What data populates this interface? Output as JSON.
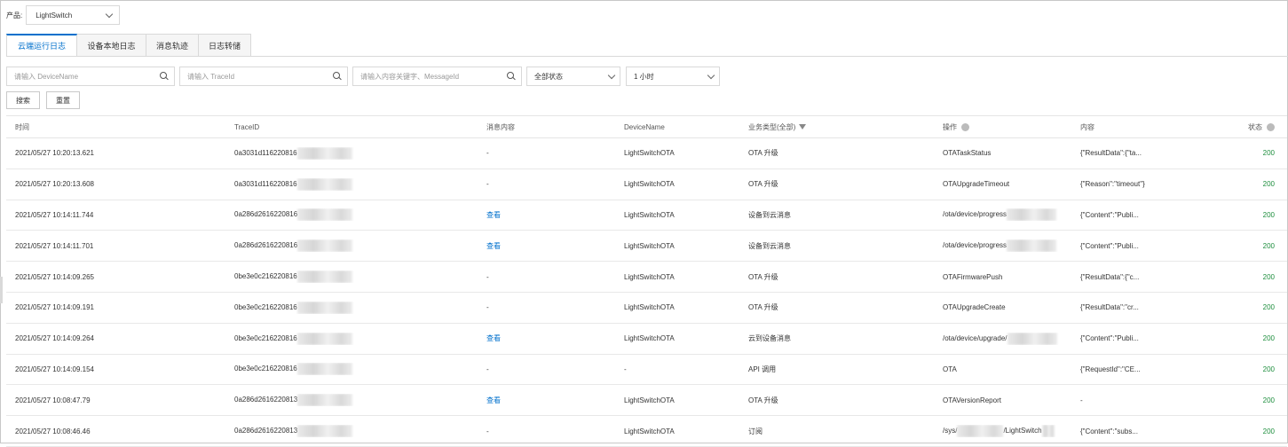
{
  "product": {
    "label": "产品:",
    "value": "LightSwitch"
  },
  "tabs": [
    {
      "label": "云端运行日志",
      "active": true
    },
    {
      "label": "设备本地日志",
      "active": false
    },
    {
      "label": "消息轨迹",
      "active": false
    },
    {
      "label": "日志转储",
      "active": false
    }
  ],
  "filters": {
    "device_placeholder": "请输入 DeviceName",
    "trace_placeholder": "请输入 TraceId",
    "keyword_placeholder": "请输入内容关键字、MessageId",
    "status_value": "全部状态",
    "time_value": "1 小时"
  },
  "buttons": {
    "search": "搜索",
    "reset": "重置"
  },
  "columns": {
    "time": "时间",
    "trace": "TraceID",
    "msg": "消息内容",
    "device": "DeviceName",
    "type": "业务类型(全部)",
    "op": "操作",
    "content": "内容",
    "status": "状态"
  },
  "rows": [
    {
      "time": "2021/05/27 10:20:13.621",
      "trace": "0a3031d116220816",
      "msg": "-",
      "msg_link": false,
      "device": "LightSwitchOTA",
      "type": "OTA 升级",
      "op": "OTATaskStatus",
      "op_blur": false,
      "content": "{\"ResultData\":{\"ta...",
      "status": "200"
    },
    {
      "time": "2021/05/27 10:20:13.608",
      "trace": "0a3031d116220816",
      "msg": "-",
      "msg_link": false,
      "device": "LightSwitchOTA",
      "type": "OTA 升级",
      "op": "OTAUpgradeTimeout",
      "op_blur": false,
      "content": "{\"Reason\":\"timeout\"}",
      "status": "200"
    },
    {
      "time": "2021/05/27 10:14:11.744",
      "trace": "0a286d2616220816",
      "msg": "查看",
      "msg_link": true,
      "device": "LightSwitchOTA",
      "type": "设备到云消息",
      "op": "/ota/device/progress",
      "op_blur": true,
      "content": "{\"Content\":\"Publi...",
      "status": "200"
    },
    {
      "time": "2021/05/27 10:14:11.701",
      "trace": "0a286d2616220816",
      "msg": "查看",
      "msg_link": true,
      "device": "LightSwitchOTA",
      "type": "设备到云消息",
      "op": "/ota/device/progress",
      "op_blur": true,
      "content": "{\"Content\":\"Publi...",
      "status": "200"
    },
    {
      "time": "2021/05/27 10:14:09.265",
      "trace": "0be3e0c216220816",
      "msg": "-",
      "msg_link": false,
      "device": "LightSwitchOTA",
      "type": "OTA 升级",
      "op": "OTAFirmwarePush",
      "op_blur": false,
      "content": "{\"ResultData\":{\"c...",
      "status": "200"
    },
    {
      "time": "2021/05/27 10:14:09.191",
      "trace": "0be3e0c216220816",
      "msg": "-",
      "msg_link": false,
      "device": "LightSwitchOTA",
      "type": "OTA 升级",
      "op": "OTAUpgradeCreate",
      "op_blur": false,
      "content": "{\"ResultData\":\"cr...",
      "status": "200"
    },
    {
      "time": "2021/05/27 10:14:09.264",
      "trace": "0be3e0c216220816",
      "msg": "查看",
      "msg_link": true,
      "device": "LightSwitchOTA",
      "type": "云到设备消息",
      "op": "/ota/device/upgrade/",
      "op_blur": true,
      "content": "{\"Content\":\"Publi...",
      "status": "200"
    },
    {
      "time": "2021/05/27 10:14:09.154",
      "trace": "0be3e0c216220816",
      "msg": "-",
      "msg_link": false,
      "device": "-",
      "type": "API 调用",
      "op": "OTA",
      "op_blur": false,
      "content": "{\"RequestId\":\"CE...",
      "status": "200"
    },
    {
      "time": "2021/05/27 10:08:47.79",
      "trace": "0a286d2616220813",
      "msg": "查看",
      "msg_link": true,
      "device": "LightSwitchOTA",
      "type": "OTA 升级",
      "op": "OTAVersionReport",
      "op_blur": false,
      "content": "-",
      "status": "200"
    },
    {
      "time": "2021/05/27 10:08:46.46",
      "trace": "0a286d2616220813",
      "msg": "-",
      "msg_link": false,
      "device": "LightSwitchOTA",
      "type": "订阅",
      "op": "/sys/",
      "op_blur": true,
      "op_suffix": "/LightSwitch",
      "content": "{\"Content\":\"subs...",
      "status": "200"
    }
  ],
  "colors": {
    "accent": "#0070cc",
    "status_ok": "#1e8e3e"
  }
}
